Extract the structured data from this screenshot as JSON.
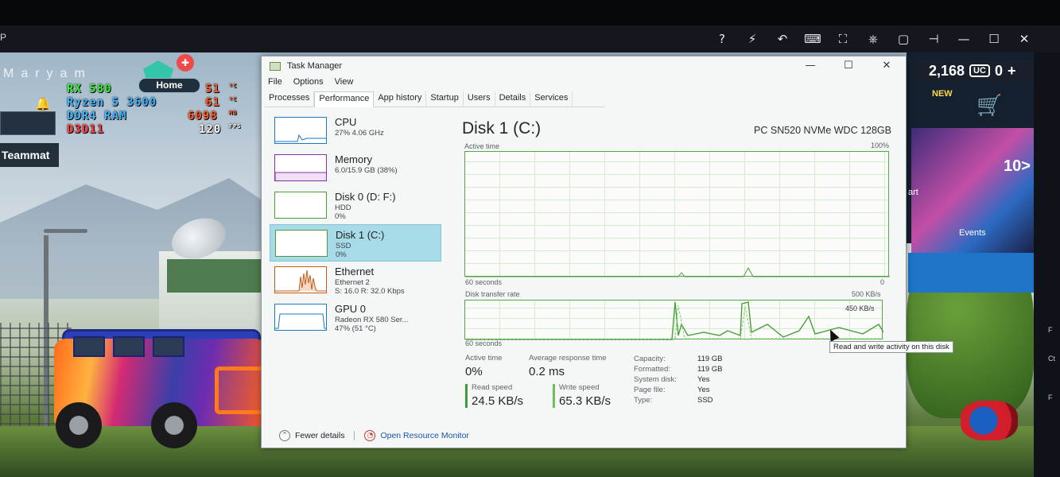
{
  "emulator": {
    "left_glyph": "P",
    "toolbar_icons": [
      "help-icon",
      "lightning-icon",
      "undo-icon",
      "keyboard-icon",
      "fullscreen-icon",
      "steering-icon",
      "restore-window-icon",
      "pin-icon",
      "minimize-icon",
      "maximize-icon",
      "close-icon"
    ],
    "toolbar_glyphs": [
      "?",
      "⚡",
      "↶",
      "⌨",
      "⛶",
      "⎈",
      "▢",
      "⊣",
      "—",
      "☐",
      "✕"
    ]
  },
  "game": {
    "player_name": "Maryam",
    "home_label": "Home",
    "teammate_label": "Teammat",
    "hud": {
      "gpu": "RX 580",
      "cpu": "Ryzen 5 3600",
      "ram": "DDR4 RAM",
      "api": "D3D11",
      "gpu_temp": "51",
      "cpu_temp": "61",
      "mem_mb": "6098",
      "fps": "120",
      "unit_c1": "ºC",
      "unit_c2": "ºC",
      "unit_mb": "MB",
      "unit_fps": "FPS"
    },
    "currency": "2,168",
    "uc_label": "UC",
    "uc_value": "0",
    "new_label": "NEW",
    "next_label": "10",
    "poster_label": "art",
    "events_label": "Events",
    "right_strip": [
      "F",
      "Ct",
      "F"
    ]
  },
  "task_manager": {
    "title": "Task Manager",
    "menu": [
      "File",
      "Options",
      "View"
    ],
    "tabs": [
      "Processes",
      "Performance",
      "App history",
      "Startup",
      "Users",
      "Details",
      "Services"
    ],
    "active_tab": "Performance",
    "sidebar": [
      {
        "title": "CPU",
        "line1": "27%  4.06 GHz",
        "line2": "",
        "color": "#1a7ac7"
      },
      {
        "title": "Memory",
        "line1": "6.0/15.9 GB (38%)",
        "line2": "",
        "color": "#8a2fa8"
      },
      {
        "title": "Disk 0 (D: F:)",
        "line1": "HDD",
        "line2": "0%",
        "color": "#4a9e3a"
      },
      {
        "title": "Disk 1 (C:)",
        "line1": "SSD",
        "line2": "0%",
        "color": "#4a9e3a"
      },
      {
        "title": "Ethernet",
        "line1": "Ethernet 2",
        "line2": "S: 16.0  R: 32.0 Kbps",
        "color": "#c45a1a"
      },
      {
        "title": "GPU 0",
        "line1": "Radeon RX 580 Ser...",
        "line2": "47% (51 °C)",
        "color": "#1a7ac7"
      }
    ],
    "main": {
      "title": "Disk 1 (C:)",
      "device": "PC SN520 NVMe WDC 128GB",
      "graph1_label": "Active time",
      "graph1_max": "100%",
      "graph1_xlabel": "60 seconds",
      "graph1_min": "0",
      "graph2_label": "Disk transfer rate",
      "graph2_max": "500 KB/s",
      "graph2_mid": "450 KB/s",
      "graph2_xlabel": "60 seconds",
      "tooltip": "Read and write activity on this disk",
      "active_time_label": "Active time",
      "active_time_value": "0%",
      "avg_resp_label": "Average response time",
      "avg_resp_value": "0.2 ms",
      "read_label": "Read speed",
      "read_value": "24.5 KB/s",
      "write_label": "Write speed",
      "write_value": "65.3 KB/s",
      "props": [
        {
          "k": "Capacity:",
          "v": "119 GB"
        },
        {
          "k": "Formatted:",
          "v": "119 GB"
        },
        {
          "k": "System disk:",
          "v": "Yes"
        },
        {
          "k": "Page file:",
          "v": "Yes"
        },
        {
          "k": "Type:",
          "v": "SSD"
        }
      ]
    },
    "footer": {
      "fewer_details": "Fewer details",
      "open_monitor": "Open Resource Monitor"
    }
  }
}
